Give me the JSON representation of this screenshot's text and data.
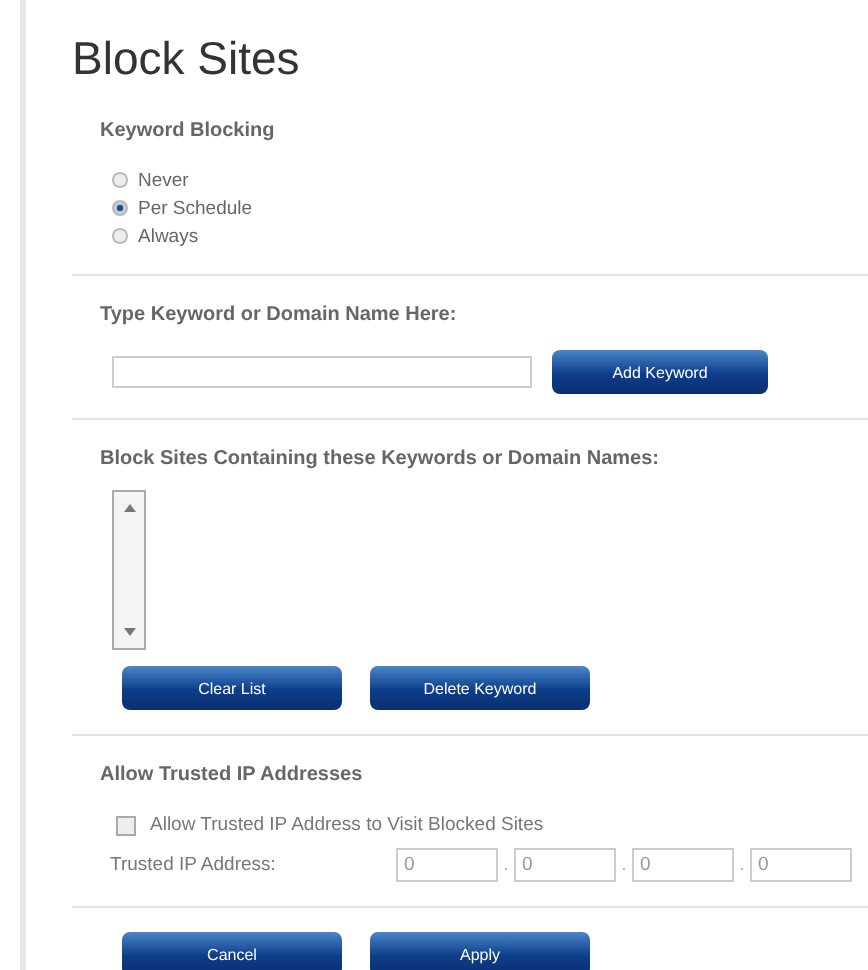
{
  "title": "Block Sites",
  "keyword_blocking": {
    "heading": "Keyword Blocking",
    "options": [
      {
        "label": "Never",
        "selected": false
      },
      {
        "label": "Per Schedule",
        "selected": true
      },
      {
        "label": "Always",
        "selected": false
      }
    ]
  },
  "keyword_entry": {
    "heading": "Type Keyword or Domain Name Here:",
    "button": "Add Keyword"
  },
  "blocked_list": {
    "heading": "Block Sites Containing these Keywords or Domain Names:",
    "buttons": [
      "Clear List",
      "Delete Keyword"
    ]
  },
  "trusted": {
    "heading": "Allow Trusted IP Addresses",
    "checkbox": {
      "label": "Allow Trusted IP Address to Visit Blocked Sites",
      "checked": false
    },
    "ip_label": "Trusted IP Address:",
    "octets": [
      "0",
      "0",
      "0",
      "0"
    ],
    "separators": [
      ".",
      ".",
      "."
    ]
  },
  "buttons": [
    "Cancel",
    "Apply"
  ]
}
